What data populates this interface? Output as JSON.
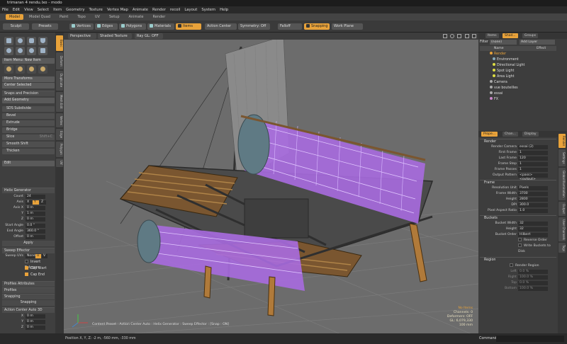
{
  "window_title": "trimaran 4 rendu.lxo - modo",
  "menu": [
    "File",
    "Edit",
    "View",
    "Select",
    "Item",
    "Geometry",
    "Texture",
    "Vertex Map",
    "Animate",
    "Render",
    "recoil",
    "Layout",
    "System",
    "Help"
  ],
  "layout_tabs": [
    "Model",
    "Model Quad",
    "Paint",
    "Topo",
    "UV",
    "Setup",
    "Animate",
    "Render"
  ],
  "toolbar": {
    "sculpt": "Sculpt",
    "presets": "Presets",
    "vertices": "Vertices",
    "edges": "Edges",
    "polygons": "Polygons",
    "materials": "Materials",
    "items": "Items",
    "action_center": "Action Center",
    "symmetry": "Symmetry: Off",
    "falloff": "Falloff",
    "snapping": "Snapping",
    "work_plane": "Work Plane"
  },
  "left": {
    "item_menu": "Item Menu: New Item",
    "more_transforms": "More Transforms",
    "center_selected": "Center Selected",
    "snaps_header": "Snaps and Precision",
    "add_geometry": "Add Geometry",
    "tools": [
      "SDS Subdivide",
      "Bevel",
      "Extrude",
      "Bridge",
      "Slice",
      "Smooth Shift",
      "Thicken"
    ],
    "tool_keys": [
      "",
      "",
      "",
      "",
      "Shift+C",
      "",
      ""
    ],
    "edit": "Edit",
    "helix_header": "Helix Generator",
    "count_label": "Count",
    "count": "24",
    "axis_label": "Axis",
    "axis_x": "X",
    "axis_y": "Y",
    "axis_z": "Z",
    "axisx_label": "Axis X",
    "axisx": "0 m",
    "y_label": "Y",
    "y": "1 m",
    "z_label": "Z",
    "z": "0 m",
    "start_angle_label": "Start Angle",
    "start_angle": "0.0 °",
    "end_angle_label": "End Angle",
    "end_angle": "360.0 °",
    "offset_label": "Offset",
    "offset": "0 m",
    "apply": "Apply",
    "sweep_header": "Sweep Effector",
    "sweep_uvs_label": "Sweep UVs",
    "sweep_none": "None",
    "sweep_u": "U",
    "sweep_v": "V",
    "invert_polygons": "Invert Polygons",
    "cap_start": "Cap Start",
    "cap_end": "Cap End",
    "profiles_attr": "Profiles Attributes",
    "profiles": "Profiles",
    "snapping_header": "Snapping",
    "snapping_btn": "Snapping",
    "action_center_header": "Action Center Auto 3D",
    "ac_x_label": "X",
    "ac_x": "0 m",
    "ac_y_label": "Y",
    "ac_y": "0 m",
    "ac_z_label": "Z",
    "ac_z": "0 m"
  },
  "left_vtabs": [
    "Basic",
    "Deform",
    "Duplicate",
    "Mesh Edit",
    "Vertex",
    "Edge",
    "Polygon",
    "UV"
  ],
  "viewport": {
    "perspective": "Perspective",
    "shading": "Shaded Texture",
    "ray_gl": "Ray GL: OFF",
    "info": [
      "No Items",
      "Channels: 0",
      "Deformers: OFF",
      "GL: 6,079,330",
      "100 mm"
    ],
    "footer": "Content Preset : Action Center Auto : Helix Generator : Sweep Effector : [Snap : ON]"
  },
  "status": {
    "position": "Position X, Y, Z:  -2 m, -560 mm, -330 mm",
    "command_label": "Command"
  },
  "right": {
    "tabs_top": [
      "Items",
      "Shad...",
      "Groups"
    ],
    "filter_label": "Filter",
    "filter_value": "(none)",
    "add_layer": "Add Layer",
    "col_name": "Name",
    "col_effect": "Effect",
    "tree": [
      "Render",
      "Environment",
      "Directional Light",
      "Spot Light",
      "Area Light",
      "Camera",
      "vue bouteilles",
      "essai",
      "FX"
    ],
    "tabs_mid": [
      "Prope...",
      "Chan...",
      "Display"
    ],
    "render_section": "Render",
    "render_camera_label": "Render Camera",
    "render_camera": "essai (2)",
    "first_frame_label": "First Frame",
    "first_frame": "1",
    "last_frame_label": "Last Frame",
    "last_frame": "120",
    "frame_step_label": "Frame Step",
    "frame_step": "1",
    "frame_passes_label": "Frame Passes",
    "frame_passes": "1",
    "output_pattern_label": "Output Pattern",
    "output_pattern": "<pass> <output>",
    "frame_section": "Frame",
    "resolution_unit_label": "Resolution Unit",
    "resolution_unit": "Pixels",
    "frame_width_label": "Frame Width",
    "frame_width": "3700",
    "height_label": "Height",
    "height": "2800",
    "dpi_label": "DPI",
    "dpi": "300.0",
    "pixel_aspect_label": "Pixel Aspect Ratio",
    "pixel_aspect": "1.0",
    "buckets_section": "Buckets",
    "bucket_width_label": "Bucket Width",
    "bucket_width": "32",
    "bucket_height_label": "Height",
    "bucket_height": "32",
    "bucket_order_label": "Bucket Order",
    "bucket_order": "Hilbert",
    "reverse_order": "Reverse Order",
    "write_buckets": "Write Buckets to Disk",
    "region_section": "Region",
    "render_region": "Render Region",
    "left_label": "Left",
    "left_val": "0.0 %",
    "right_label": "Right",
    "right_val": "100.0 %",
    "top_label": "Top",
    "top_val": "0.0 %",
    "bottom_label": "Bottom",
    "bottom_val": "100.0 %"
  },
  "right_vtabs": [
    "Render",
    "Settings",
    "Global Illumination",
    "Output",
    "User Channels",
    "Tags"
  ]
}
